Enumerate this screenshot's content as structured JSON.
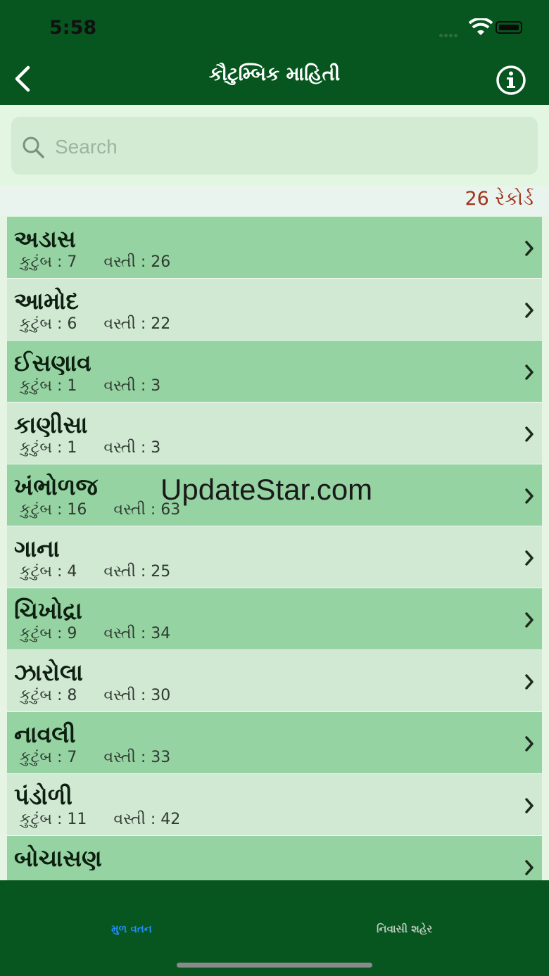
{
  "status_bar": {
    "time": "5:58"
  },
  "header": {
    "title": "કૌટુમ્બિક માહિતી",
    "back_icon": "chevron-left-icon",
    "info_icon": "info-circle-icon"
  },
  "search": {
    "placeholder": "Search",
    "value": ""
  },
  "records": {
    "label": "26 રેકોર્ડ"
  },
  "list": {
    "items": [
      {
        "name": "અડાસ",
        "families": "કુટુંબ : 7",
        "population": "વસ્તી : 26"
      },
      {
        "name": "આમોદ",
        "families": "કુટુંબ : 6",
        "population": "વસ્તી : 22"
      },
      {
        "name": "ઈસણાવ",
        "families": "કુટુંબ : 1",
        "population": "વસ્તી : 3"
      },
      {
        "name": "કાણીસા",
        "families": "કુટુંબ : 1",
        "population": "વસ્તી : 3"
      },
      {
        "name": "ખંભોળજ",
        "families": "કુટુંબ : 16",
        "population": "વસ્તી : 63"
      },
      {
        "name": "ગાના",
        "families": "કુટુંબ : 4",
        "population": "વસ્તી : 25"
      },
      {
        "name": "ચિખોદ્રા",
        "families": "કુટુંબ : 9",
        "population": "વસ્તી : 34"
      },
      {
        "name": "ઝારોલા",
        "families": "કુટુંબ : 8",
        "population": "વસ્તી : 30"
      },
      {
        "name": "નાવલી",
        "families": "કુટુંબ : 7",
        "population": "વસ્તી : 33"
      },
      {
        "name": "પંડોળી",
        "families": "કુટુંબ : 11",
        "population": "વસ્તી : 42"
      },
      {
        "name": "બોચાસણ",
        "families": "",
        "population": ""
      }
    ]
  },
  "watermark": "UpdateStar.com",
  "tabbar": {
    "tabs": [
      {
        "label": "મુળ વતન",
        "active": true
      },
      {
        "label": "નિવાસી શહેર",
        "active": false
      }
    ]
  },
  "colors": {
    "header_bg": "#07561f",
    "row_dark": "#96d3a2",
    "row_light": "#d1e8d3",
    "records_text": "#a0341c",
    "active_tab": "#1f8cff"
  }
}
